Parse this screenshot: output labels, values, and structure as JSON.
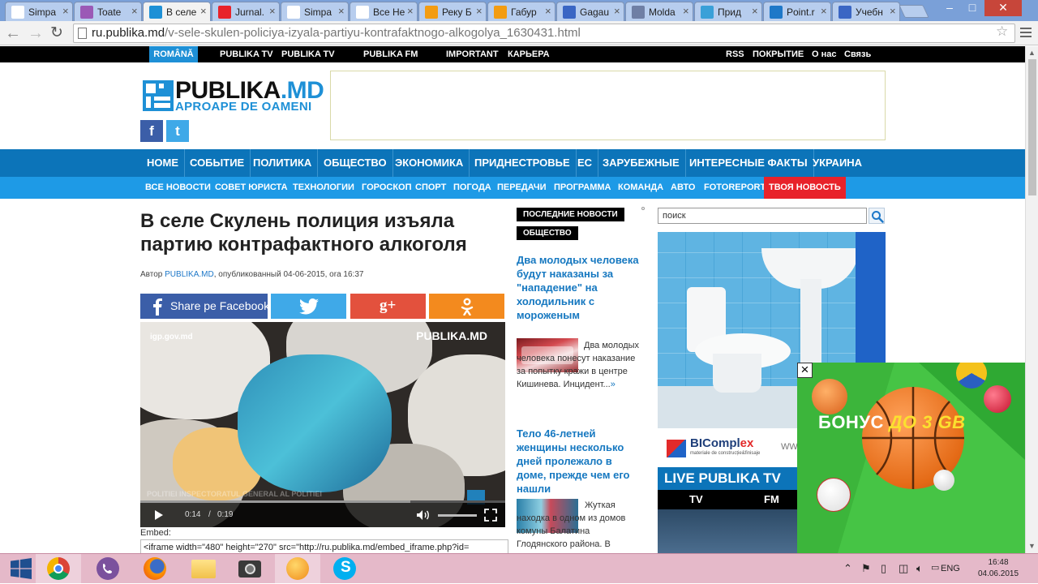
{
  "browser": {
    "tabs": [
      {
        "label": "Simpa",
        "fav": "#ffffff",
        "active": false
      },
      {
        "label": "Toate",
        "fav": "#9b59b6",
        "active": false
      },
      {
        "label": "В селе",
        "fav": "#1e90d6",
        "active": true
      },
      {
        "label": "Jurnal.",
        "fav": "#e8222a",
        "active": false
      },
      {
        "label": "Simpa",
        "fav": "#ffffff",
        "active": false
      },
      {
        "label": "Все Не",
        "fav": "#ffffff",
        "active": false
      },
      {
        "label": "Реку Б",
        "fav": "#f39c12",
        "active": false
      },
      {
        "label": "Габур",
        "fav": "#f39c12",
        "active": false
      },
      {
        "label": "Gagau",
        "fav": "#3a66c4",
        "active": false
      },
      {
        "label": "Molda",
        "fav": "#6f7fa5",
        "active": false
      },
      {
        "label": "Прид",
        "fav": "#3aa0d8",
        "active": false
      },
      {
        "label": "Point.r",
        "fav": "#1e78c8",
        "active": false
      },
      {
        "label": "Учебн",
        "fav": "#3a66c4",
        "active": false
      }
    ],
    "tab_close": "×",
    "url_host": "ru.publika.md",
    "url_path": "/v-sele-skulen-policiya-izyala-partiyu-kontrafaktnogo-alkogolya_1630431.html",
    "minimize": "–",
    "maximize": "□",
    "close": "✕"
  },
  "topstrip": {
    "lang": "ROMÂNĂ",
    "items": [
      {
        "pre": "",
        "label": "PUBLIKA TV"
      },
      {
        "pre": "LIVE",
        "label": " PUBLIKA TV"
      },
      {
        "pre": "LIVE",
        "label": " PUBLIKA FM"
      },
      {
        "pre": "",
        "label": "IMPORTANT"
      },
      {
        "pre": "",
        "label": "КАРЬЕРА"
      }
    ],
    "right_items": [
      "RSS",
      "ПОКРЫТИЕ",
      "О нас",
      "Связь"
    ]
  },
  "logo": {
    "name_a": "PUBLIKA",
    "name_b": ".MD",
    "slogan": "APROAPE DE OAMENI"
  },
  "social": {
    "facebook": "f",
    "twitter": "t"
  },
  "mainnav": [
    "HOME",
    "СОБЫТИЕ",
    "ПОЛИТИКА",
    "ОБЩЕСТВО",
    "ЭКОНОМИКА",
    "ПРИДНЕСТРОВЬЕ",
    "ЕС",
    "ЗАРУБЕЖНЫЕ",
    "ИНТЕРЕСНЫЕ ФАКТЫ",
    "УКРАИНА"
  ],
  "subnav": [
    "ВСЕ НОВОСТИ",
    "СОВЕТ ЮРИСТА",
    "ТЕХНОЛОГИИ",
    "ГОРОСКОП",
    "СПОРТ",
    "ПОГОДА",
    "ПЕРЕДАЧИ",
    "ПРОГРАММА",
    "КОМАНДА",
    "АВТО",
    "FOTOREPORT",
    "ТВОЯ НОВОСТЬ"
  ],
  "article": {
    "title": "В селе Скулень полиция изъяла партию контрафактного алкоголя",
    "byline_prefix": "Автор ",
    "author": "PUBLIKA.MD",
    "byline_suffix": ", опубликованный 04-06-2015, ora 16:37",
    "share_facebook": "Share pe Facebook",
    "video": {
      "watermark": "PUBLIKA.MD",
      "source": "igp.gov.md",
      "caption": "POLITIEI  INSPECTORATUL GENERAL AL POLITIEI",
      "current": "0:14",
      "separator": "/",
      "duration": "0:19",
      "progress": 0.74
    },
    "embed_label": "Embed:",
    "embed_code": "<iframe width=\"480\" height=\"270\" src=\"http://ru.publika.md/embed_iframe.php?id="
  },
  "news": {
    "tag_latest": "ПОСЛЕДНИЕ НОВОСТИ",
    "tag_category": "ОБЩЕСТВО",
    "items": [
      {
        "title": "Два молодых человека будут наказаны за \"нападение\" на холодильник с мороженым",
        "body": "Два молодых человека понесут наказание за попытку кражи в центре Кишинева. Инцидент...",
        "more": "»"
      },
      {
        "title": "Тело 46-летней женщины несколько дней пролежало в доме, прежде чем его нашли",
        "body": "Жуткая находка в одном из домов комуны Балатина Глодянского района. В"
      }
    ]
  },
  "sidebar": {
    "search_placeholder": "поиск",
    "ad_brand": "BICompl",
    "ad_brand_tail": "ex",
    "ad_tagline": "materiale de construcție&finisaje",
    "ad_url": "WW",
    "live_title": "LIVE PUBLIKA TV",
    "live_tabs": [
      "TV",
      "FM"
    ]
  },
  "popup": {
    "bonus_a": "БОНУС",
    "bonus_b": "ДО 3 GB"
  },
  "taskbar": {
    "lang": "ENG",
    "time": "16:48",
    "date": "04.06.2015"
  }
}
